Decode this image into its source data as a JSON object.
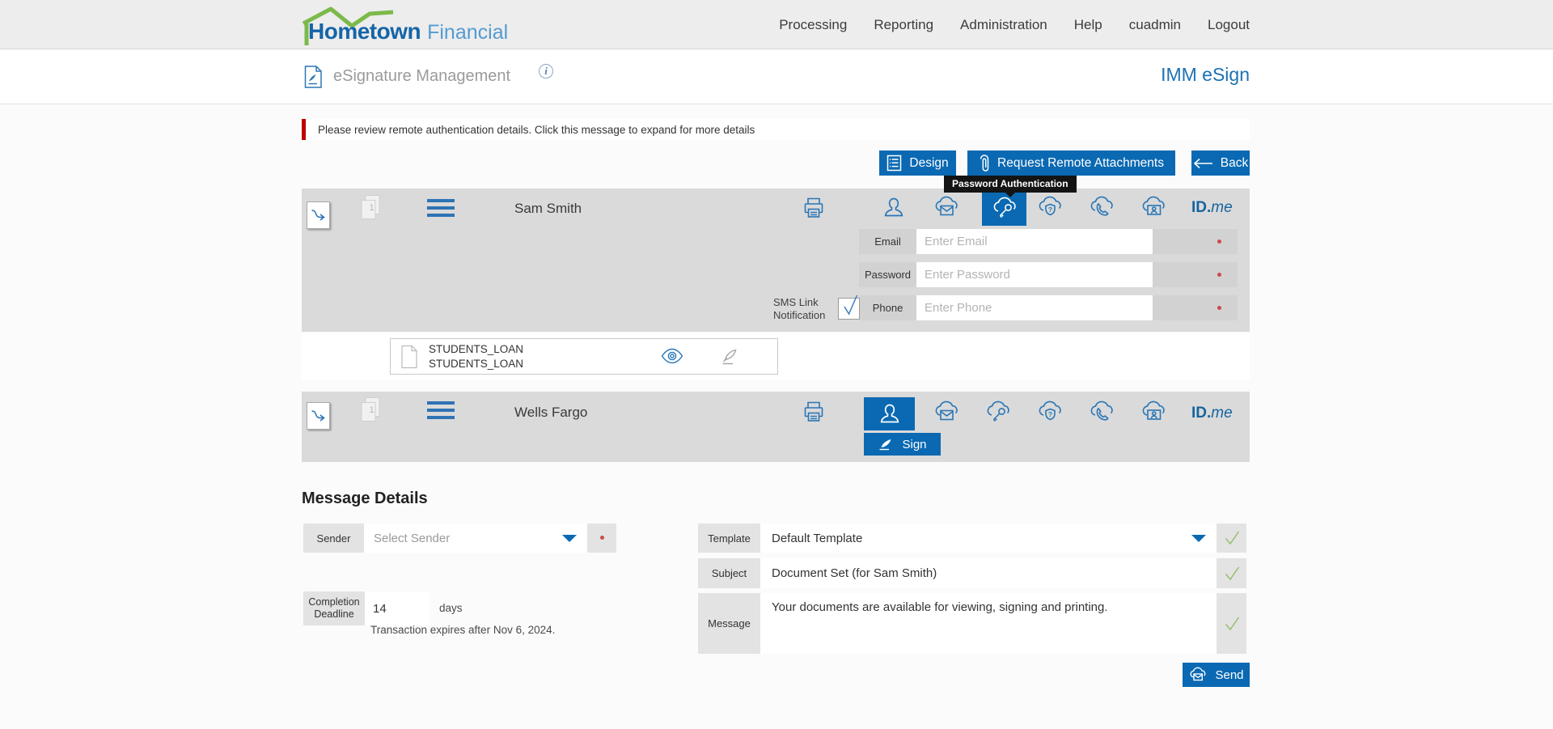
{
  "brand": {
    "bold": "Hometown",
    "light": "Financial"
  },
  "nav": {
    "items": [
      "Processing",
      "Reporting",
      "Administration",
      "Help",
      "cuadmin",
      "Logout"
    ]
  },
  "header": {
    "title": "eSignature Management",
    "info": "i",
    "product": "IMM eSign"
  },
  "alert_text": "Please review remote authentication details. Click this message to expand for more details",
  "toolbar": {
    "design": "Design",
    "attachments": "Request Remote Attachments",
    "back": "Back"
  },
  "tooltip_text": "Password Authentication",
  "idme": {
    "bold": "ID.",
    "italic": "me"
  },
  "signers": {
    "sam": {
      "name": "Sam Smith",
      "doc_count": "1",
      "fields": {
        "email": {
          "label": "Email",
          "placeholder": "Enter Email"
        },
        "password": {
          "label": "Password",
          "placeholder": "Enter Password"
        },
        "phone": {
          "label": "Phone",
          "placeholder": "Enter Phone"
        }
      },
      "sms": {
        "line1": "SMS Link",
        "line2": "Notification"
      }
    },
    "wells": {
      "name": "Wells Fargo",
      "doc_count": "1",
      "sign": "Sign"
    }
  },
  "document": {
    "line1": "STUDENTS_LOAN",
    "line2": "STUDENTS_LOAN"
  },
  "details": {
    "heading": "Message Details",
    "sender_label": "Sender",
    "sender_placeholder": "Select Sender",
    "completion_label1": "Completion",
    "completion_label2": "Deadline",
    "completion_value": "14",
    "completion_unit": "days",
    "expiry_note": "Transaction expires after Nov 6, 2024.",
    "template_label": "Template",
    "template_value": "Default Template",
    "subject_label": "Subject",
    "subject_value": "Document Set (for Sam Smith)",
    "message_label": "Message",
    "message_value": "Your documents are available for viewing, signing and printing.",
    "send": "Send"
  },
  "colors": {
    "accent_blue": "#0a69b2",
    "icon_blue": "#2a76b6",
    "alert_red": "#c00000",
    "check_green": "#95bf70"
  }
}
